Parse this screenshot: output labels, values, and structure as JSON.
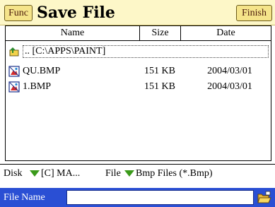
{
  "title_bar": {
    "func_label": "Func",
    "title": "Save File",
    "finish_label": "Finish"
  },
  "columns": {
    "name": "Name",
    "size": "Size",
    "date": "Date"
  },
  "files": [
    {
      "name": ".. [C:\\APPS\\PAINT]",
      "size": "",
      "date": "",
      "icon": "parent-folder-icon"
    },
    {
      "name": "QU.BMP",
      "size": "151 KB",
      "date": "2004/03/01",
      "icon": "bmp-file-icon"
    },
    {
      "name": "1.BMP",
      "size": "151 KB",
      "date": "2004/03/01",
      "icon": "bmp-file-icon"
    }
  ],
  "filter_bar": {
    "disk_label": "Disk",
    "disk_value": "[C] MA...",
    "file_label": "File",
    "file_type_value": "Bmp Files (*.Bmp)"
  },
  "file_name_bar": {
    "label": "File Name",
    "value": "",
    "browse_icon": "folder-open-icon"
  },
  "colors": {
    "title_background": "#fdf7c8",
    "button_background": "#f5e48a",
    "file_name_bar": "#2a4fd4",
    "dropdown_arrow": "#3a9a1a"
  }
}
